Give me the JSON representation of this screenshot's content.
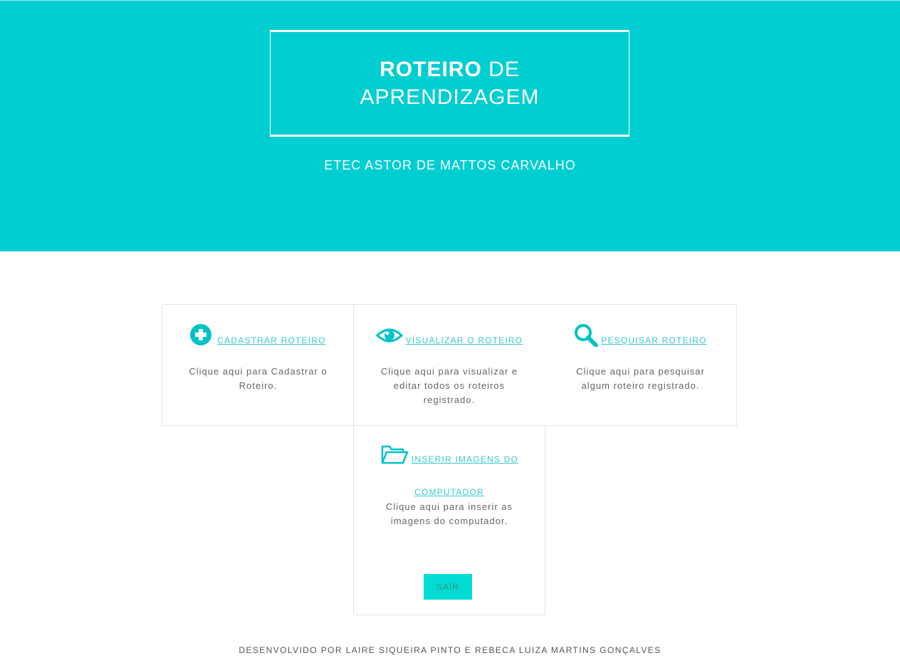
{
  "header": {
    "title_bold": "ROTEIRO",
    "title_light": "DE",
    "title_line2": "APRENDIZAGEM",
    "school": "ETEC ASTOR DE MATTOS CARVALHO"
  },
  "cards": [
    {
      "icon": "plus-circle-icon",
      "link": "CADASTRAR ROTEIRO ",
      "desc": "Clique aqui para Cadastrar o Roteiro."
    },
    {
      "icon": "eye-icon",
      "link": "VISUALIZAR O ROTEIRO",
      "desc": "Clique aqui para visualizar e editar todos os roteiros registrado."
    },
    {
      "icon": "search-icon",
      "link": "PESQUISAR ROTEIRO",
      "desc": "Clique aqui para pesquisar algum roteiro registrado."
    },
    {
      "icon": "folder-open-icon",
      "link": "INSERIR IMAGENS DO",
      "link_line2": "COMPUTADOR",
      "desc": "Clique aqui para inserir as imagens do computador."
    }
  ],
  "logout_label": "SAIR",
  "footer": "DESENVOLVIDO POR LAIRE SIQUEIRA PINTO E REBECA LUIZA MARTINS GONÇALVES",
  "colors": {
    "accent": "#00ced1",
    "link": "#38c8ca",
    "button": "#00dcd4"
  }
}
